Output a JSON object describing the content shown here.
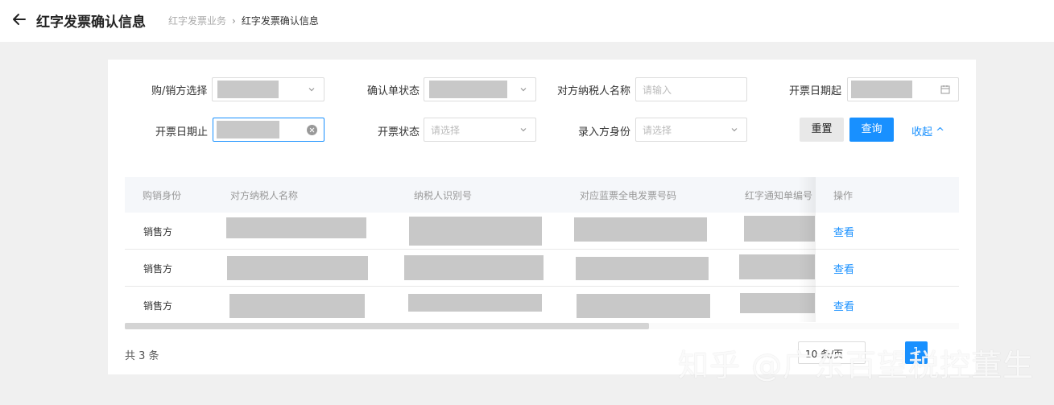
{
  "header": {
    "title": "红字发票确认信息",
    "breadcrumb": [
      "红字发票业务",
      "红字发票确认信息"
    ],
    "breadcrumb_sep": "›"
  },
  "filters": {
    "buyer_seller_label": "购/销方选择",
    "confirm_status_label": "确认单状态",
    "counterparty_name_label": "对方纳税人名称",
    "counterparty_name_placeholder": "请输入",
    "date_from_label": "开票日期起",
    "date_to_label": "开票日期止",
    "invoice_status_label": "开票状态",
    "invoice_status_placeholder": "请选择",
    "entry_role_label": "录入方身份",
    "entry_role_placeholder": "请选择",
    "reset_label": "重置",
    "query_label": "查询",
    "collapse_label": "收起 ^"
  },
  "table": {
    "columns": [
      "购销身份",
      "对方纳税人名称",
      "纳税人识别号",
      "对应蓝票全电发票号码",
      "红字通知单编号",
      "操作"
    ],
    "rows": [
      {
        "role": "销售方",
        "action": "查看"
      },
      {
        "role": "销售方",
        "action": "查看"
      },
      {
        "role": "销售方",
        "action": "查看"
      }
    ]
  },
  "pagination": {
    "total_text": "共 3 条",
    "page_size_text": "10 条/页",
    "current_page": "1"
  },
  "watermark": "知乎 @广东百望税控董生",
  "colors": {
    "accent": "#1890ff",
    "redaction": "#c8c8c8",
    "page_bg": "#f0f0f0"
  }
}
